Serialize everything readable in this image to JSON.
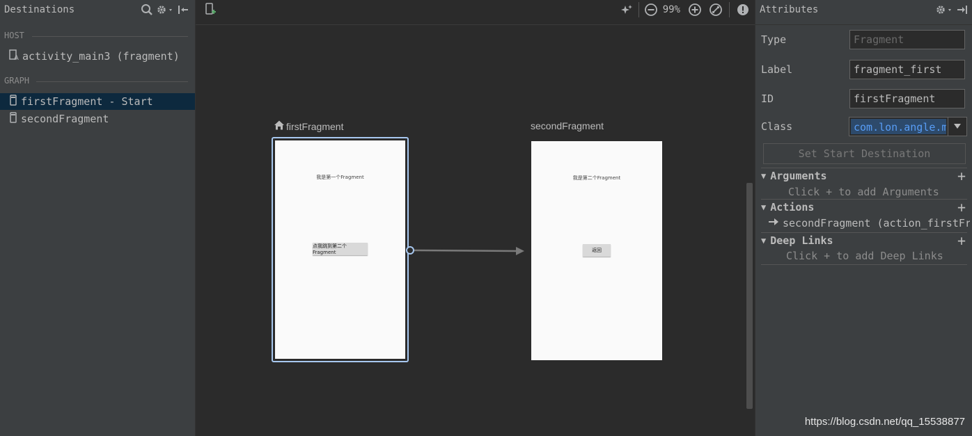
{
  "left_panel": {
    "title": "Destinations",
    "host_label": "HOST",
    "host_item": "activity_main3 (fragment)",
    "graph_label": "GRAPH",
    "graph_items": [
      "firstFragment - Start",
      "secondFragment"
    ]
  },
  "canvas": {
    "zoom": "99%",
    "first_fragment": {
      "title": "firstFragment",
      "text": "我是第一个Fragment",
      "button": "点我跳到第二个Fragment"
    },
    "second_fragment": {
      "title": "secondFragment",
      "text": "我是第二个Fragment",
      "button": "返回"
    }
  },
  "attributes": {
    "title": "Attributes",
    "type_label": "Type",
    "type_placeholder": "Fragment",
    "label_label": "Label",
    "label_value": "fragment_first",
    "id_label": "ID",
    "id_value": "firstFragment",
    "class_label": "Class",
    "class_value": "com.lon.angle.m",
    "set_start_button": "Set Start Destination",
    "arguments_title": "Arguments",
    "arguments_hint": "Click + to add Arguments",
    "actions_title": "Actions",
    "action_item": "secondFragment (action_firstFr",
    "deeplinks_title": "Deep Links",
    "deeplinks_hint": "Click + to add Deep Links"
  },
  "watermark": "https://blog.csdn.net/qq_15538877",
  "icons": [
    "search-icon",
    "gear-icon",
    "collapse-icon",
    "new-destination-icon",
    "auto-arrange-icon",
    "zoom-out-icon",
    "zoom-in-icon",
    "zoom-fit-icon",
    "warning-icon",
    "home-icon",
    "phone-icon",
    "layout-icon",
    "add-icon",
    "pin-icon"
  ]
}
